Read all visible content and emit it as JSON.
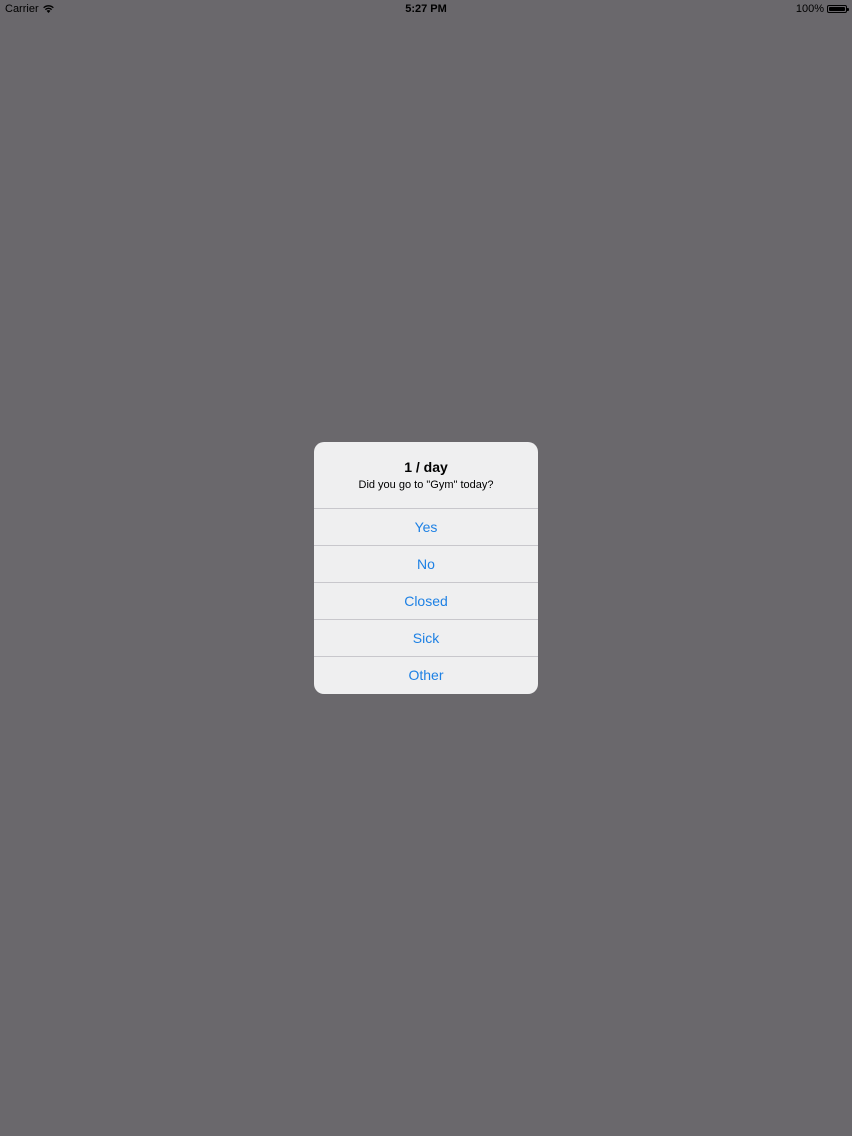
{
  "status_bar": {
    "carrier": "Carrier",
    "time": "5:27 PM",
    "battery": "100%",
    "wifi_icon": "wifi-icon",
    "battery_icon": "battery-icon"
  },
  "colors": {
    "background_dim": "#6a686c",
    "alert_background": "#efeff0",
    "action_tint": "#1d80e4",
    "separator": "#c8c7cc"
  },
  "alert": {
    "title": "1 / day",
    "message": "Did you go to \"Gym\" today?",
    "buttons": [
      {
        "label": "Yes"
      },
      {
        "label": "No"
      },
      {
        "label": "Closed"
      },
      {
        "label": "Sick"
      },
      {
        "label": "Other"
      }
    ]
  }
}
